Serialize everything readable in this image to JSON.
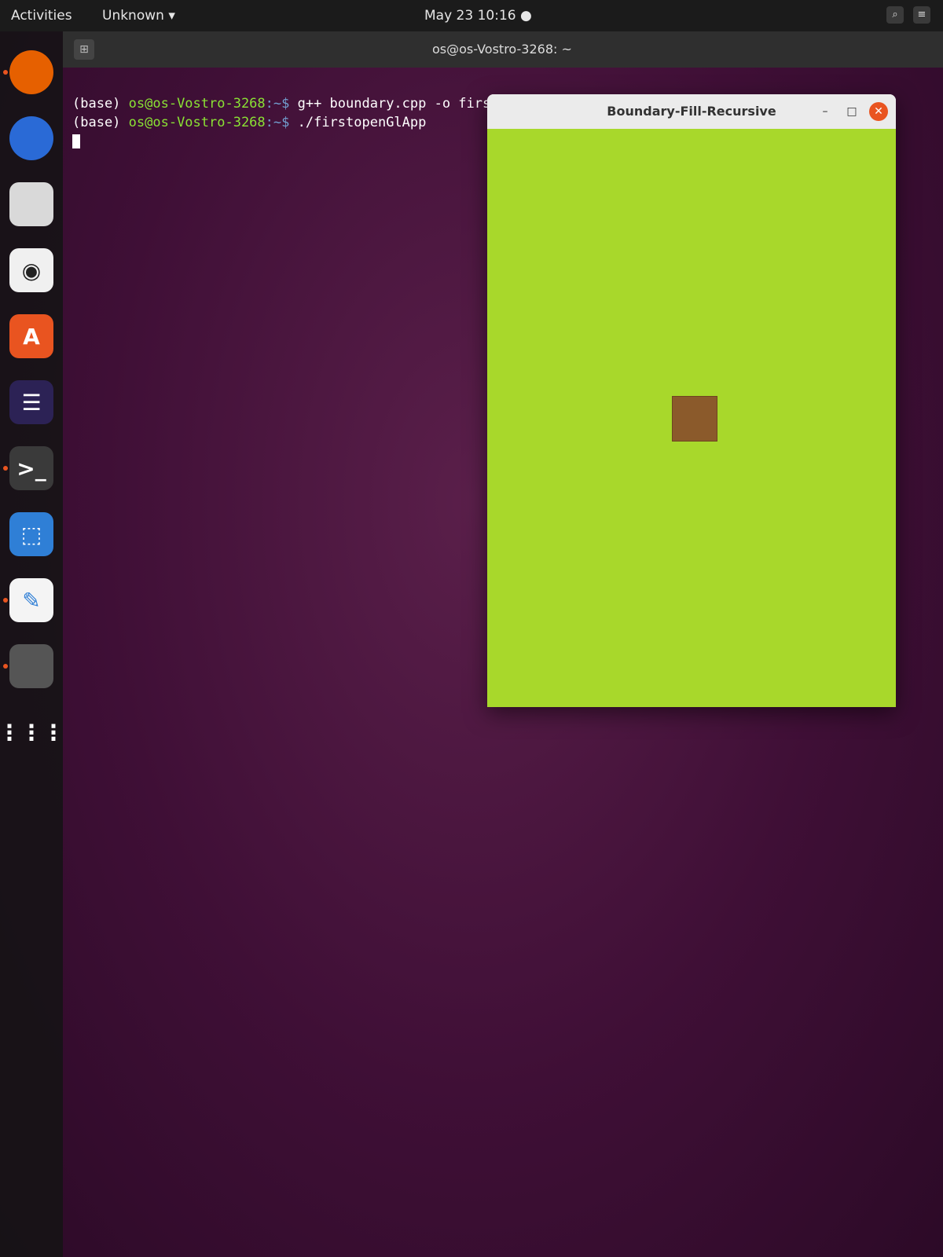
{
  "topbar": {
    "activities": "Activities",
    "app_menu": "Unknown ▾",
    "clock": "May 23 10:16 ●",
    "icons": [
      "search-icon",
      "menu-icon"
    ]
  },
  "terminal": {
    "title": "os@os-Vostro-3268: ~",
    "lines": [
      {
        "env": "(base) ",
        "user": "os@os-Vostro-3268",
        "path": ":~$ ",
        "cmd": "g++ boundary.cpp -o firstopenGlApp -lglut -lGLU -lGL"
      },
      {
        "env": "(base) ",
        "user": "os@os-Vostro-3268",
        "path": ":~$ ",
        "cmd": "./firstopenGlApp"
      }
    ]
  },
  "gl_window": {
    "title": "Boundary-Fill-Recursive",
    "minimize": "–",
    "maximize": "□",
    "close": "✕",
    "background_color": "#a8d82b",
    "square_color": "#8b5a2b"
  },
  "dock": {
    "items": [
      {
        "name": "firefox-icon",
        "glyph": "",
        "bg": "#e66000",
        "running": true
      },
      {
        "name": "thunderbird-icon",
        "glyph": "",
        "bg": "#2a6ad6",
        "running": false
      },
      {
        "name": "files-icon",
        "glyph": "",
        "bg": "#d9d9d9",
        "running": false
      },
      {
        "name": "rhythmbox-icon",
        "glyph": "◉",
        "bg": "#f0f0f0",
        "running": false
      },
      {
        "name": "software-center-icon",
        "glyph": "A",
        "bg": "#e95420",
        "running": false
      },
      {
        "name": "eclipse-icon",
        "glyph": "☰",
        "bg": "#2c2255",
        "running": false
      },
      {
        "name": "terminal-icon",
        "glyph": ">_",
        "bg": "#3a3a3a",
        "running": true
      },
      {
        "name": "screenshot-icon",
        "glyph": "⬚",
        "bg": "#2f7fd6",
        "running": false
      },
      {
        "name": "text-editor-icon",
        "glyph": "✎",
        "bg": "#f4f4f4",
        "running": true
      },
      {
        "name": "glut-app-icon",
        "glyph": "",
        "bg": "#555555",
        "running": true
      },
      {
        "name": "show-apps-icon",
        "glyph": "⋮⋮⋮",
        "bg": "transparent",
        "running": false
      }
    ]
  }
}
